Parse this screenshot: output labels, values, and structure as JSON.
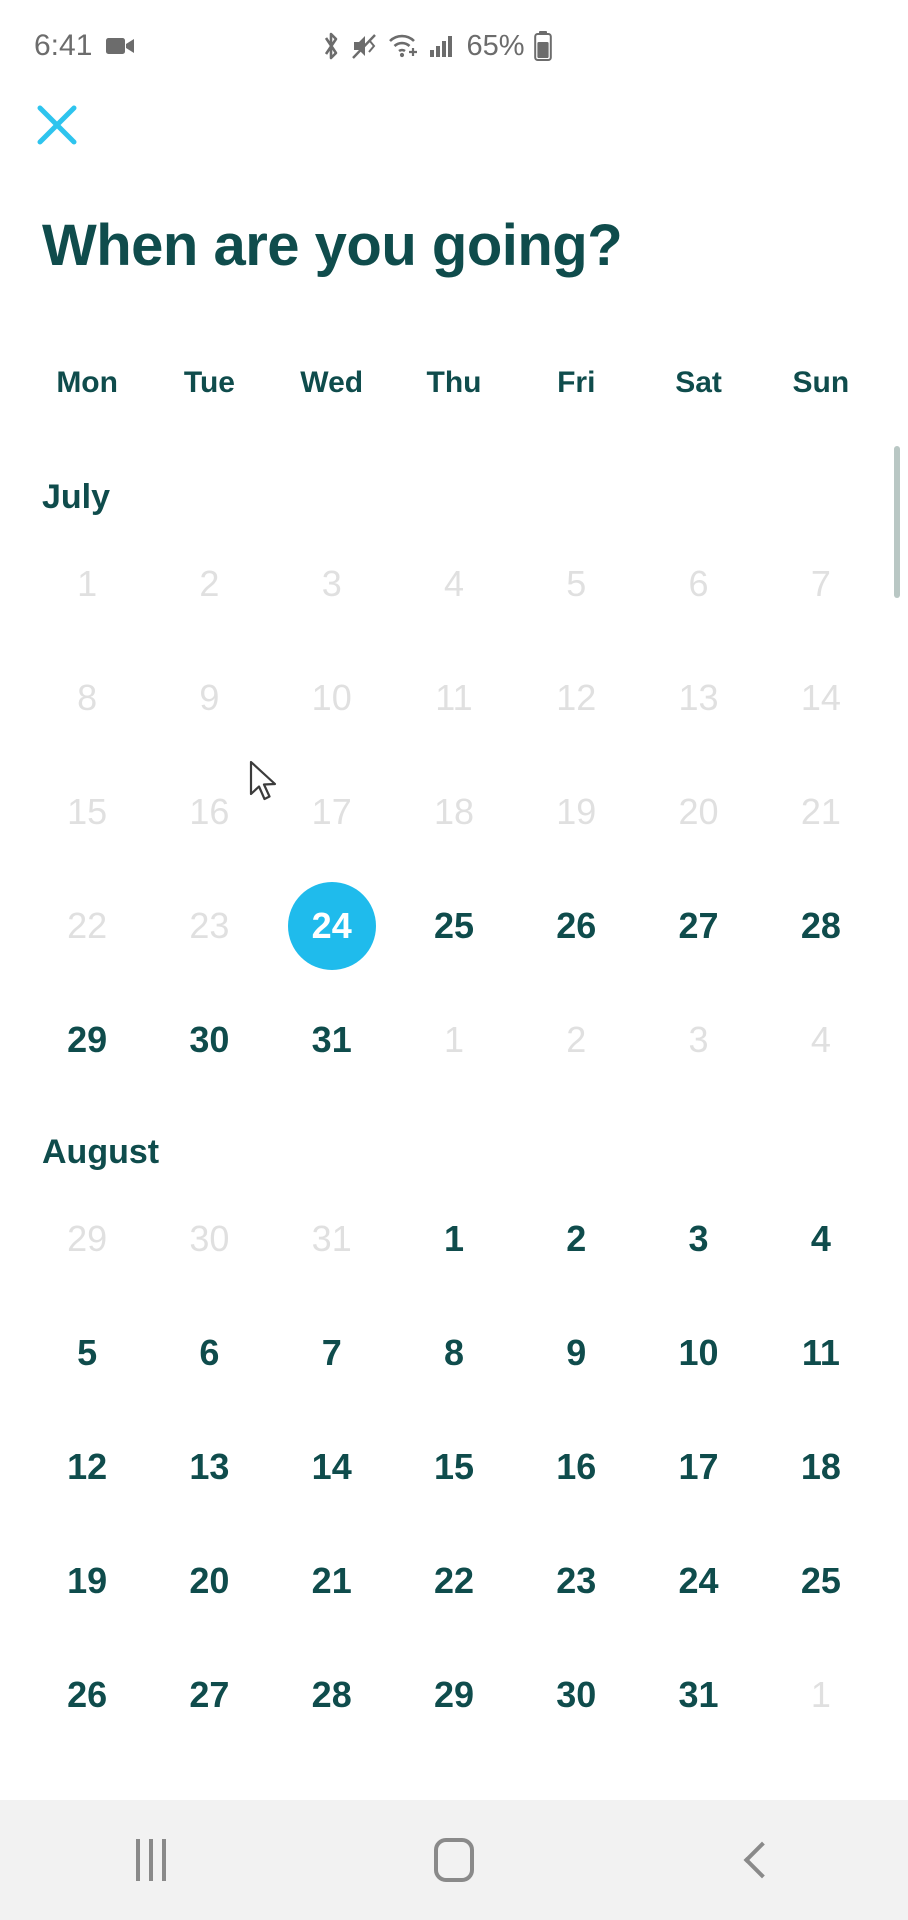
{
  "status_bar": {
    "time": "6:41",
    "battery_percent": "65%",
    "icons": [
      "video-recording-icon",
      "bluetooth-icon",
      "mute-vibrate-icon",
      "wifi-icon",
      "cellular-signal-icon",
      "battery-icon"
    ]
  },
  "header": {
    "close_label": "✕",
    "title": "When are you going?"
  },
  "calendar": {
    "weekdays": [
      "Mon",
      "Tue",
      "Wed",
      "Thu",
      "Fri",
      "Sat",
      "Sun"
    ],
    "selected_day": "24",
    "selected_month": "July",
    "accent_color": "#1fbbec",
    "text_color": "#0f4c4c",
    "disabled_color": "#e0e0e0",
    "months": [
      {
        "name": "July",
        "weeks": [
          [
            {
              "d": "1",
              "state": "disabled"
            },
            {
              "d": "2",
              "state": "disabled"
            },
            {
              "d": "3",
              "state": "disabled"
            },
            {
              "d": "4",
              "state": "disabled"
            },
            {
              "d": "5",
              "state": "disabled"
            },
            {
              "d": "6",
              "state": "disabled"
            },
            {
              "d": "7",
              "state": "disabled"
            }
          ],
          [
            {
              "d": "8",
              "state": "disabled"
            },
            {
              "d": "9",
              "state": "disabled"
            },
            {
              "d": "10",
              "state": "disabled"
            },
            {
              "d": "11",
              "state": "disabled"
            },
            {
              "d": "12",
              "state": "disabled"
            },
            {
              "d": "13",
              "state": "disabled"
            },
            {
              "d": "14",
              "state": "disabled"
            }
          ],
          [
            {
              "d": "15",
              "state": "disabled"
            },
            {
              "d": "16",
              "state": "disabled"
            },
            {
              "d": "17",
              "state": "disabled"
            },
            {
              "d": "18",
              "state": "disabled"
            },
            {
              "d": "19",
              "state": "disabled"
            },
            {
              "d": "20",
              "state": "disabled"
            },
            {
              "d": "21",
              "state": "disabled"
            }
          ],
          [
            {
              "d": "22",
              "state": "disabled"
            },
            {
              "d": "23",
              "state": "disabled"
            },
            {
              "d": "24",
              "state": "selected"
            },
            {
              "d": "25",
              "state": "enabled"
            },
            {
              "d": "26",
              "state": "enabled"
            },
            {
              "d": "27",
              "state": "enabled"
            },
            {
              "d": "28",
              "state": "enabled"
            }
          ],
          [
            {
              "d": "29",
              "state": "enabled"
            },
            {
              "d": "30",
              "state": "enabled"
            },
            {
              "d": "31",
              "state": "enabled"
            },
            {
              "d": "1",
              "state": "disabled"
            },
            {
              "d": "2",
              "state": "disabled"
            },
            {
              "d": "3",
              "state": "disabled"
            },
            {
              "d": "4",
              "state": "disabled"
            }
          ]
        ]
      },
      {
        "name": "August",
        "weeks": [
          [
            {
              "d": "29",
              "state": "disabled"
            },
            {
              "d": "30",
              "state": "disabled"
            },
            {
              "d": "31",
              "state": "disabled"
            },
            {
              "d": "1",
              "state": "enabled"
            },
            {
              "d": "2",
              "state": "enabled"
            },
            {
              "d": "3",
              "state": "enabled"
            },
            {
              "d": "4",
              "state": "enabled"
            }
          ],
          [
            {
              "d": "5",
              "state": "enabled"
            },
            {
              "d": "6",
              "state": "enabled"
            },
            {
              "d": "7",
              "state": "enabled"
            },
            {
              "d": "8",
              "state": "enabled"
            },
            {
              "d": "9",
              "state": "enabled"
            },
            {
              "d": "10",
              "state": "enabled"
            },
            {
              "d": "11",
              "state": "enabled"
            }
          ],
          [
            {
              "d": "12",
              "state": "enabled"
            },
            {
              "d": "13",
              "state": "enabled"
            },
            {
              "d": "14",
              "state": "enabled"
            },
            {
              "d": "15",
              "state": "enabled"
            },
            {
              "d": "16",
              "state": "enabled"
            },
            {
              "d": "17",
              "state": "enabled"
            },
            {
              "d": "18",
              "state": "enabled"
            }
          ],
          [
            {
              "d": "19",
              "state": "enabled"
            },
            {
              "d": "20",
              "state": "enabled"
            },
            {
              "d": "21",
              "state": "enabled"
            },
            {
              "d": "22",
              "state": "enabled"
            },
            {
              "d": "23",
              "state": "enabled"
            },
            {
              "d": "24",
              "state": "enabled"
            },
            {
              "d": "25",
              "state": "enabled"
            }
          ],
          [
            {
              "d": "26",
              "state": "enabled"
            },
            {
              "d": "27",
              "state": "enabled"
            },
            {
              "d": "28",
              "state": "enabled"
            },
            {
              "d": "29",
              "state": "enabled"
            },
            {
              "d": "30",
              "state": "enabled"
            },
            {
              "d": "31",
              "state": "enabled"
            },
            {
              "d": "1",
              "state": "disabled"
            }
          ]
        ]
      }
    ]
  },
  "nav_bar": {
    "recents_label": "recents-button",
    "home_label": "home-button",
    "back_label": "back-button"
  }
}
